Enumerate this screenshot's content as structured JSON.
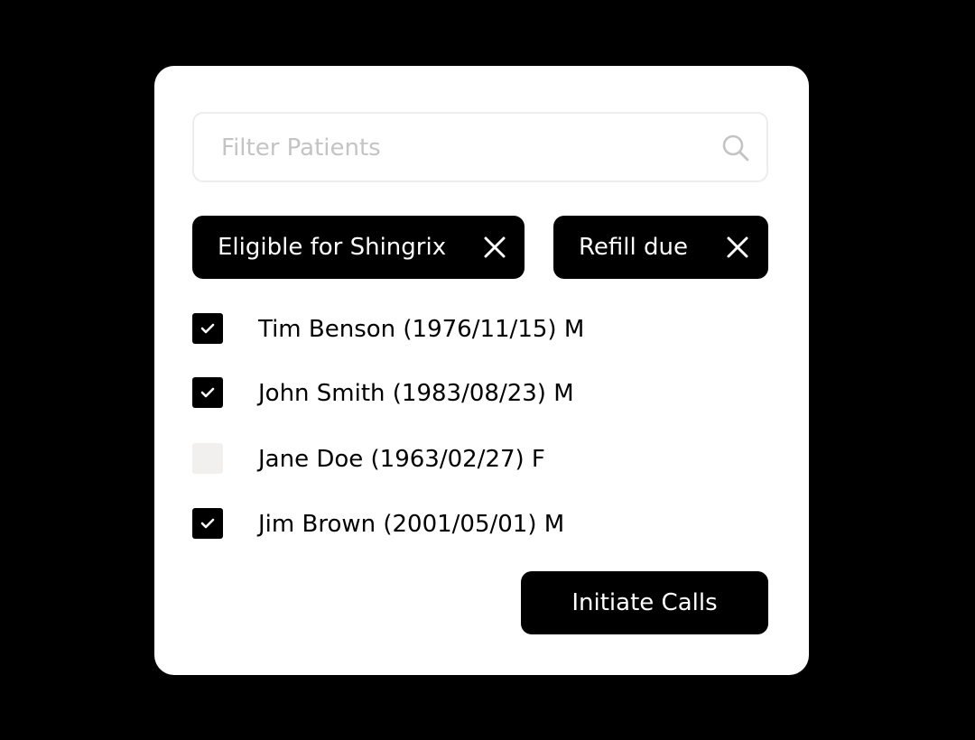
{
  "search": {
    "placeholder": "Filter Patients",
    "value": "",
    "icon": "search-icon"
  },
  "filters": [
    {
      "label": "Eligible for Shingrix",
      "remove_icon": "close-icon"
    },
    {
      "label": "Refill due",
      "remove_icon": "close-icon"
    }
  ],
  "patients": [
    {
      "label": "Tim Benson (1976/11/15) M",
      "checked": true
    },
    {
      "label": "John Smith (1983/08/23) M",
      "checked": true
    },
    {
      "label": "Jane Doe (1963/02/27) F",
      "checked": false
    },
    {
      "label": "Jim Brown (2001/05/01) M",
      "checked": true
    }
  ],
  "actions": {
    "initiate_label": "Initiate Calls"
  },
  "colors": {
    "background": "#000000",
    "card": "#ffffff",
    "accent": "#000000",
    "unchecked": "#f1f0ef",
    "placeholder": "#c4c4c4"
  }
}
